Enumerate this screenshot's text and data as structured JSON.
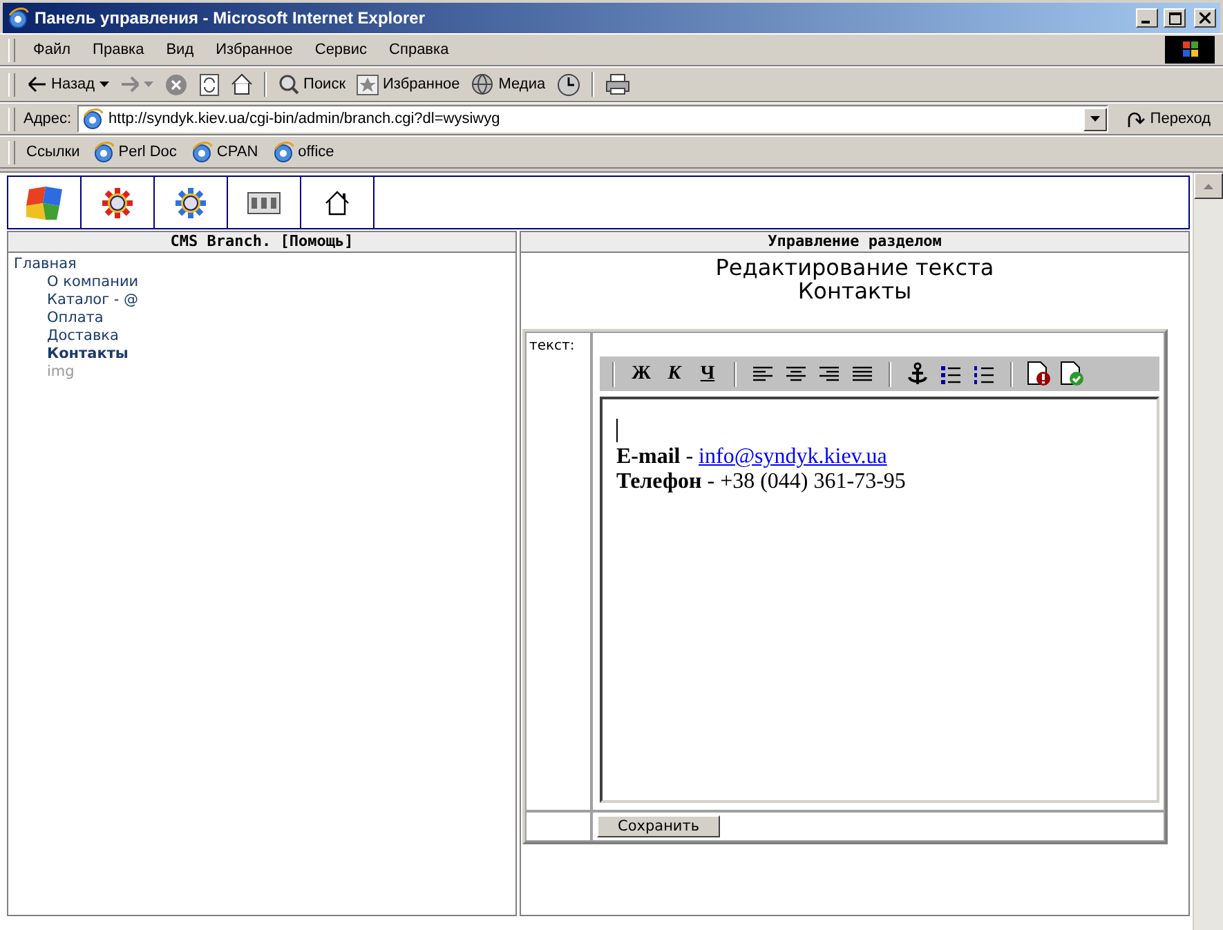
{
  "window": {
    "title": "Панель управления - Microsoft Internet Explorer"
  },
  "menu": [
    "Файл",
    "Правка",
    "Вид",
    "Избранное",
    "Сервис",
    "Справка"
  ],
  "toolbar": [
    {
      "kind": "back",
      "label": "Назад"
    },
    {
      "kind": "forward"
    },
    {
      "kind": "stop"
    },
    {
      "kind": "refresh"
    },
    {
      "kind": "home"
    },
    {
      "kind": "search",
      "label": "Поиск"
    },
    {
      "kind": "favorites",
      "label": "Избранное"
    },
    {
      "kind": "media",
      "label": "Медиа"
    },
    {
      "kind": "history"
    },
    {
      "kind": "print"
    }
  ],
  "address": {
    "label": "Адрес:",
    "value": "http://syndyk.kiev.ua/cgi-bin/admin/branch.cgi?dl=wysiwyg",
    "go": "Переход"
  },
  "links": {
    "label": "Ссылки",
    "items": [
      "Perl Doc",
      "CPAN",
      "office"
    ]
  },
  "cms_nav": [
    {
      "kind": "puzzle"
    },
    {
      "kind": "gear-red"
    },
    {
      "kind": "gear-blue"
    },
    {
      "kind": "counter"
    },
    {
      "kind": "home"
    }
  ],
  "left_panel": {
    "header": "CMS Branch. [Помощь]",
    "tree": {
      "label": "Главная",
      "children": [
        {
          "label": "О компании",
          "selected": false,
          "disabled": false
        },
        {
          "label": "Каталог - @",
          "selected": false,
          "disabled": false
        },
        {
          "label": "Оплата",
          "selected": false,
          "disabled": false
        },
        {
          "label": "Доставка",
          "selected": false,
          "disabled": false
        },
        {
          "label": "Контакты",
          "selected": true,
          "disabled": false
        },
        {
          "label": "img",
          "selected": false,
          "disabled": true
        }
      ]
    }
  },
  "right_panel": {
    "header": "Управление разделом",
    "title": [
      "Редактирование текста",
      "Контакты"
    ],
    "field_label": "текст:",
    "editor_toolbar": [
      [
        {
          "kind": "bold",
          "label": "Ж"
        },
        {
          "kind": "italic",
          "label": "К"
        },
        {
          "kind": "underline",
          "label": "Ч"
        }
      ],
      [
        {
          "kind": "align-left"
        },
        {
          "kind": "align-center"
        },
        {
          "kind": "align-right"
        },
        {
          "kind": "justify"
        }
      ],
      [
        {
          "kind": "anchor"
        },
        {
          "kind": "bullets"
        },
        {
          "kind": "numbers"
        }
      ],
      [
        {
          "kind": "cancel"
        },
        {
          "kind": "accept"
        }
      ]
    ],
    "content": [
      {
        "text": "**E-mail** - ",
        "link": "info@syndyk.kiev.ua"
      },
      {
        "text": "**Телефон** - +38 (044) 361-73-95"
      }
    ],
    "save": "Сохранить"
  }
}
